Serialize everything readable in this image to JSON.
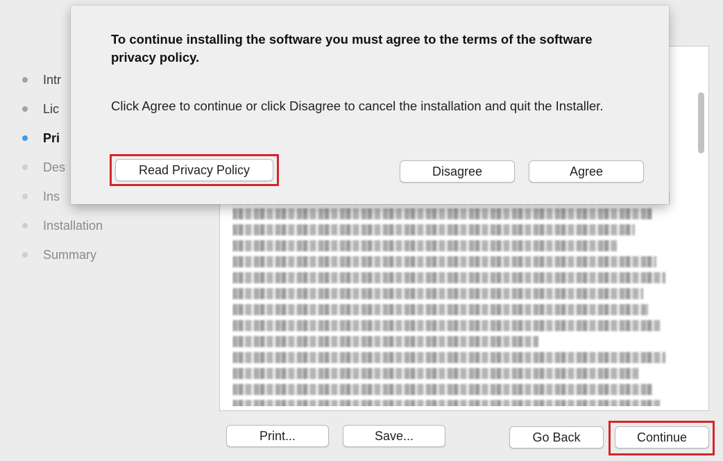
{
  "sidebar": {
    "steps": [
      {
        "label": "Intr",
        "state": "done"
      },
      {
        "label": "Lic",
        "state": "done"
      },
      {
        "label": "Pri",
        "state": "current"
      },
      {
        "label": "Des",
        "state": "pending"
      },
      {
        "label": "Ins",
        "state": "pending"
      },
      {
        "label": "Installation",
        "state": "pending"
      },
      {
        "label": "Summary",
        "state": "pending"
      }
    ]
  },
  "dialog": {
    "title": "To continue installing the software you must agree to the terms of the software privacy policy.",
    "message": "Click Agree to continue or click Disagree to cancel the installation and quit the Installer.",
    "read_policy_label": "Read Privacy Policy",
    "disagree_label": "Disagree",
    "agree_label": "Agree"
  },
  "footer": {
    "print_label": "Print...",
    "save_label": "Save...",
    "go_back_label": "Go Back",
    "continue_label": "Continue"
  },
  "colors": {
    "accent": "#3b9df0",
    "highlight": "#d3262b",
    "window_bg": "#ececec"
  }
}
